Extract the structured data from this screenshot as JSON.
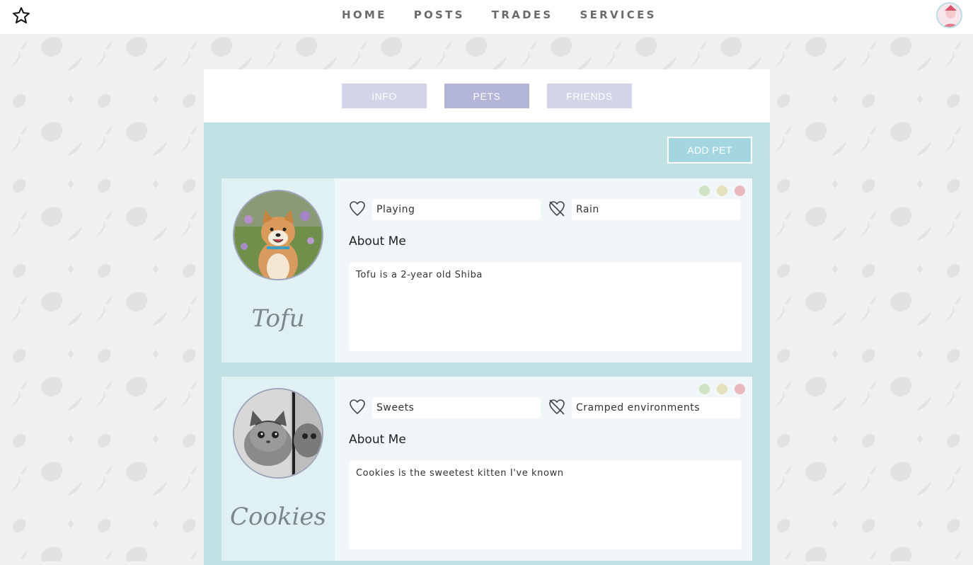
{
  "nav": {
    "links": [
      "HOME",
      "POSTS",
      "TRADES",
      "SERVICES"
    ]
  },
  "tabs": [
    "INFO",
    "PETS",
    "FRIENDS"
  ],
  "active_tab": "PETS",
  "add_pet_label": "ADD PET",
  "colors": {
    "tab_inactive": "#d3d4e8",
    "tab_active": "#b3b6d6",
    "pets_background": "#c0e1e4",
    "add_pet_button": "#a4d6e0",
    "dot_green": "#cfe4c2",
    "dot_yellow": "#e6e0bd",
    "dot_red": "#e8b8bc"
  },
  "pets": [
    {
      "name": "Tofu",
      "likes": "Playing",
      "dislikes": "Rain",
      "about_title": "About Me",
      "about_text": "Tofu is a 2-year old Shiba",
      "photo": "shiba-dog-photo"
    },
    {
      "name": "Cookies",
      "likes": "Sweets",
      "dislikes": "Cramped environments",
      "about_title": "About Me",
      "about_text": "Cookies is the sweetest kitten I've known",
      "photo": "kitten-bw-photo"
    }
  ]
}
